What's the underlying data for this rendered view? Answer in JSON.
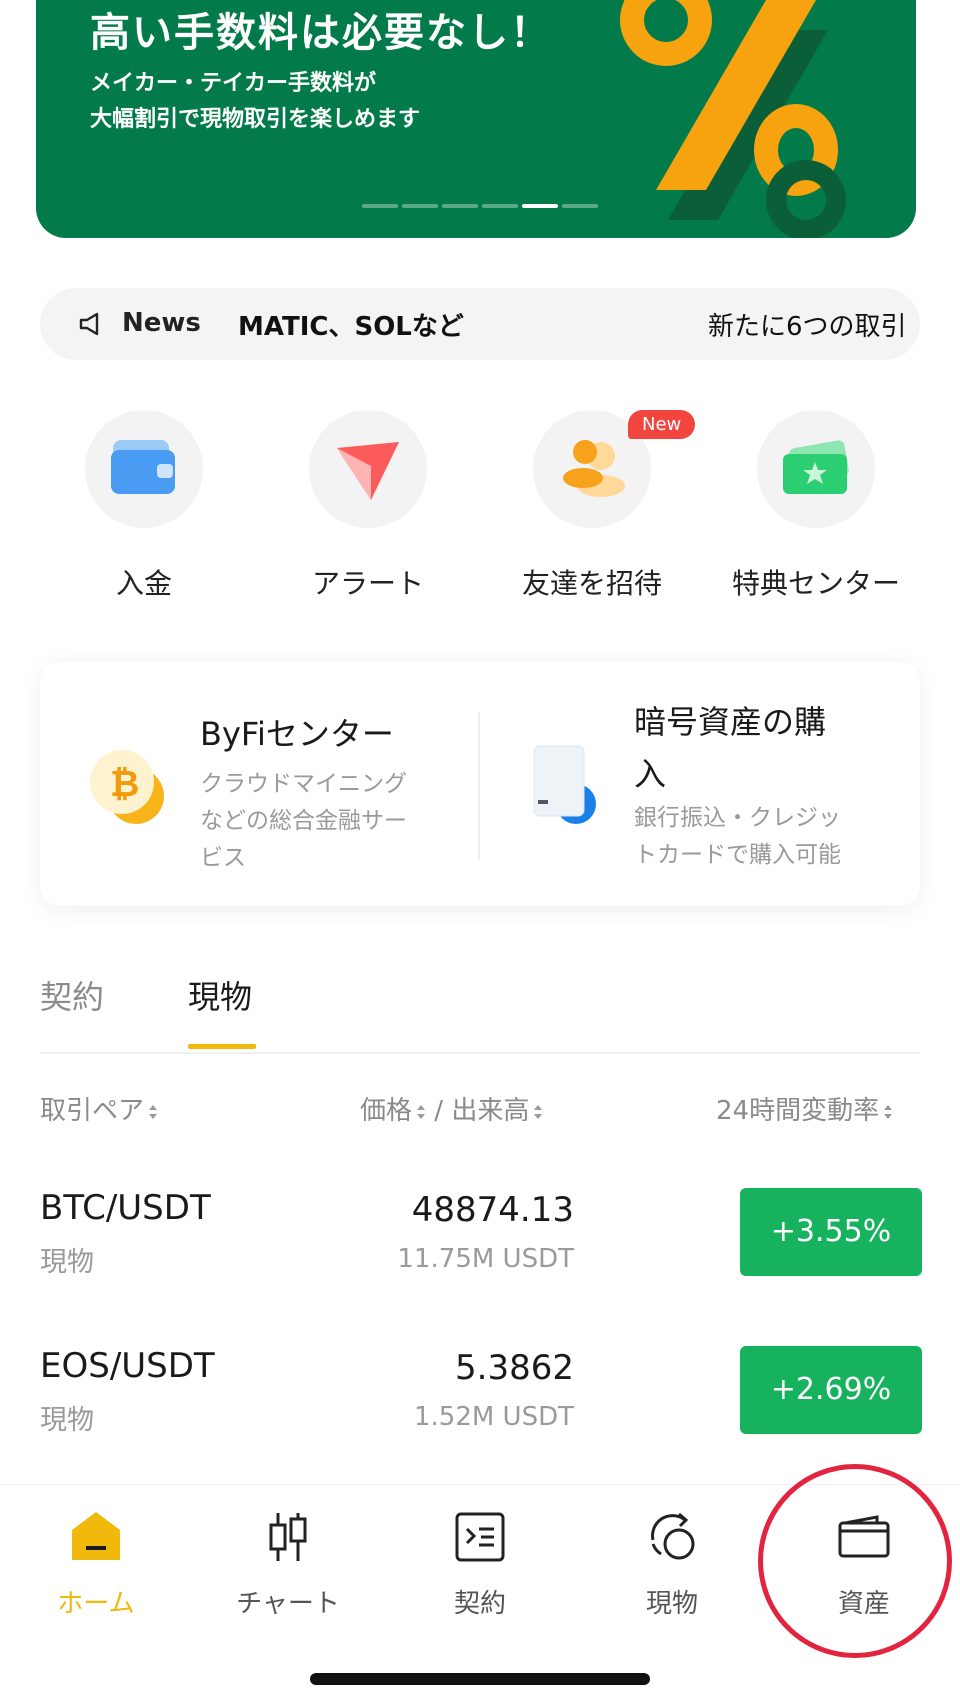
{
  "banner": {
    "title": "高い手数料は必要なし！",
    "subtitle_line1": "メイカー・テイカー手数料が",
    "subtitle_line2": "大幅割引で現物取引を楽しめます",
    "page_indicator": {
      "count": 6,
      "active_index": 4
    }
  },
  "news": {
    "label": "News",
    "text1": "MATIC、SOLなど",
    "text2": "新たに6つの取引"
  },
  "quick_actions": [
    {
      "label": "入金",
      "icon": "wallet-icon"
    },
    {
      "label": "アラート",
      "icon": "alert-icon"
    },
    {
      "label": "友達を招待",
      "icon": "invite-friends-icon",
      "badge": "New"
    },
    {
      "label": "特典センター",
      "icon": "rewards-ticket-icon"
    }
  ],
  "promo": {
    "left": {
      "title": "ByFiセンター",
      "desc_lines": [
        "クラウドマイニング",
        "などの総合金融サー",
        "ビス"
      ]
    },
    "right": {
      "title_lines": [
        "暗号資産の購",
        "入"
      ],
      "desc_lines": [
        "銀行振込・クレジッ",
        "トカードで購入可能"
      ]
    }
  },
  "market_tabs": [
    {
      "label": "契約",
      "active": false
    },
    {
      "label": "現物",
      "active": true
    }
  ],
  "columns": {
    "pair": "取引ペア",
    "price": "価格",
    "separator": "/",
    "volume": "出来高",
    "change": "24時間変動率"
  },
  "rows": [
    {
      "pair": "BTC/USDT",
      "type": "現物",
      "price": "48874.13",
      "volume": "11.75M USDT",
      "change": "+3.55%"
    },
    {
      "pair": "EOS/USDT",
      "type": "現物",
      "price": "5.3862",
      "volume": "1.52M USDT",
      "change": "+2.69%"
    }
  ],
  "nav": [
    {
      "label": "ホーム",
      "icon": "home-icon",
      "active": true
    },
    {
      "label": "チャート",
      "icon": "candlestick-chart-icon",
      "active": false
    },
    {
      "label": "契約",
      "icon": "contract-icon",
      "active": false
    },
    {
      "label": "現物",
      "icon": "spot-exchange-icon",
      "active": false
    },
    {
      "label": "資産",
      "icon": "wallet-assets-icon",
      "active": false
    }
  ],
  "colors": {
    "banner_bg": "#037a49",
    "accent_yellow": "#f0b90b",
    "positive_green": "#16b25e",
    "badge_red": "#f2453d",
    "highlight_red": "#e3243f"
  }
}
